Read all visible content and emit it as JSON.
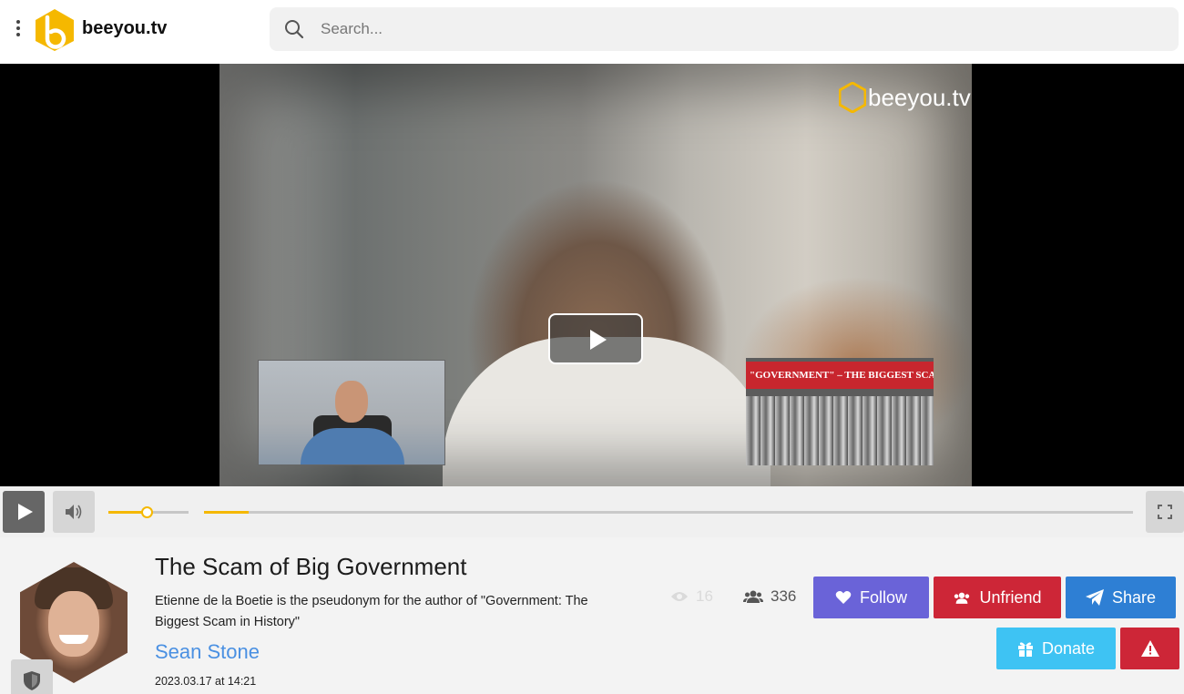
{
  "header": {
    "brand": "beeyou.tv",
    "menu_icon": "more-vertical-icon",
    "logo_icon": "beeyou-hex-logo-icon",
    "search": {
      "placeholder": "Search...",
      "value": "",
      "icon": "search-icon"
    }
  },
  "video": {
    "watermark": "beeyou.tv",
    "book_banner": "\"GOVERNMENT\" – THE BIGGEST SCAM",
    "play_icon": "play-icon"
  },
  "controls": {
    "play_icon": "play-icon",
    "volume_icon": "volume-icon",
    "volume_level": 0.48,
    "progress": 0.048,
    "fullscreen_icon": "fullscreen-icon"
  },
  "info": {
    "title": "The Scam of Big Government",
    "description": "Etienne de la Boetie is the pseudonym for the author of \"Government: The Biggest Scam in History\"",
    "author": "Sean Stone",
    "date": "2023.03.17 at 14:21",
    "badge_icon": "shield-icon"
  },
  "stats": {
    "views": "16",
    "views_icon": "eye-icon",
    "friends": "336",
    "friends_icon": "users-icon"
  },
  "actions": {
    "follow": "Follow",
    "unfriend": "Unfriend",
    "share": "Share",
    "donate": "Donate",
    "report_icon": "warning-icon"
  },
  "colors": {
    "accent": "#f5b800",
    "link": "#4a90e2",
    "follow": "#6a63d8",
    "danger": "#cd2637",
    "share": "#2e7fd4",
    "donate": "#3ec3f3"
  }
}
